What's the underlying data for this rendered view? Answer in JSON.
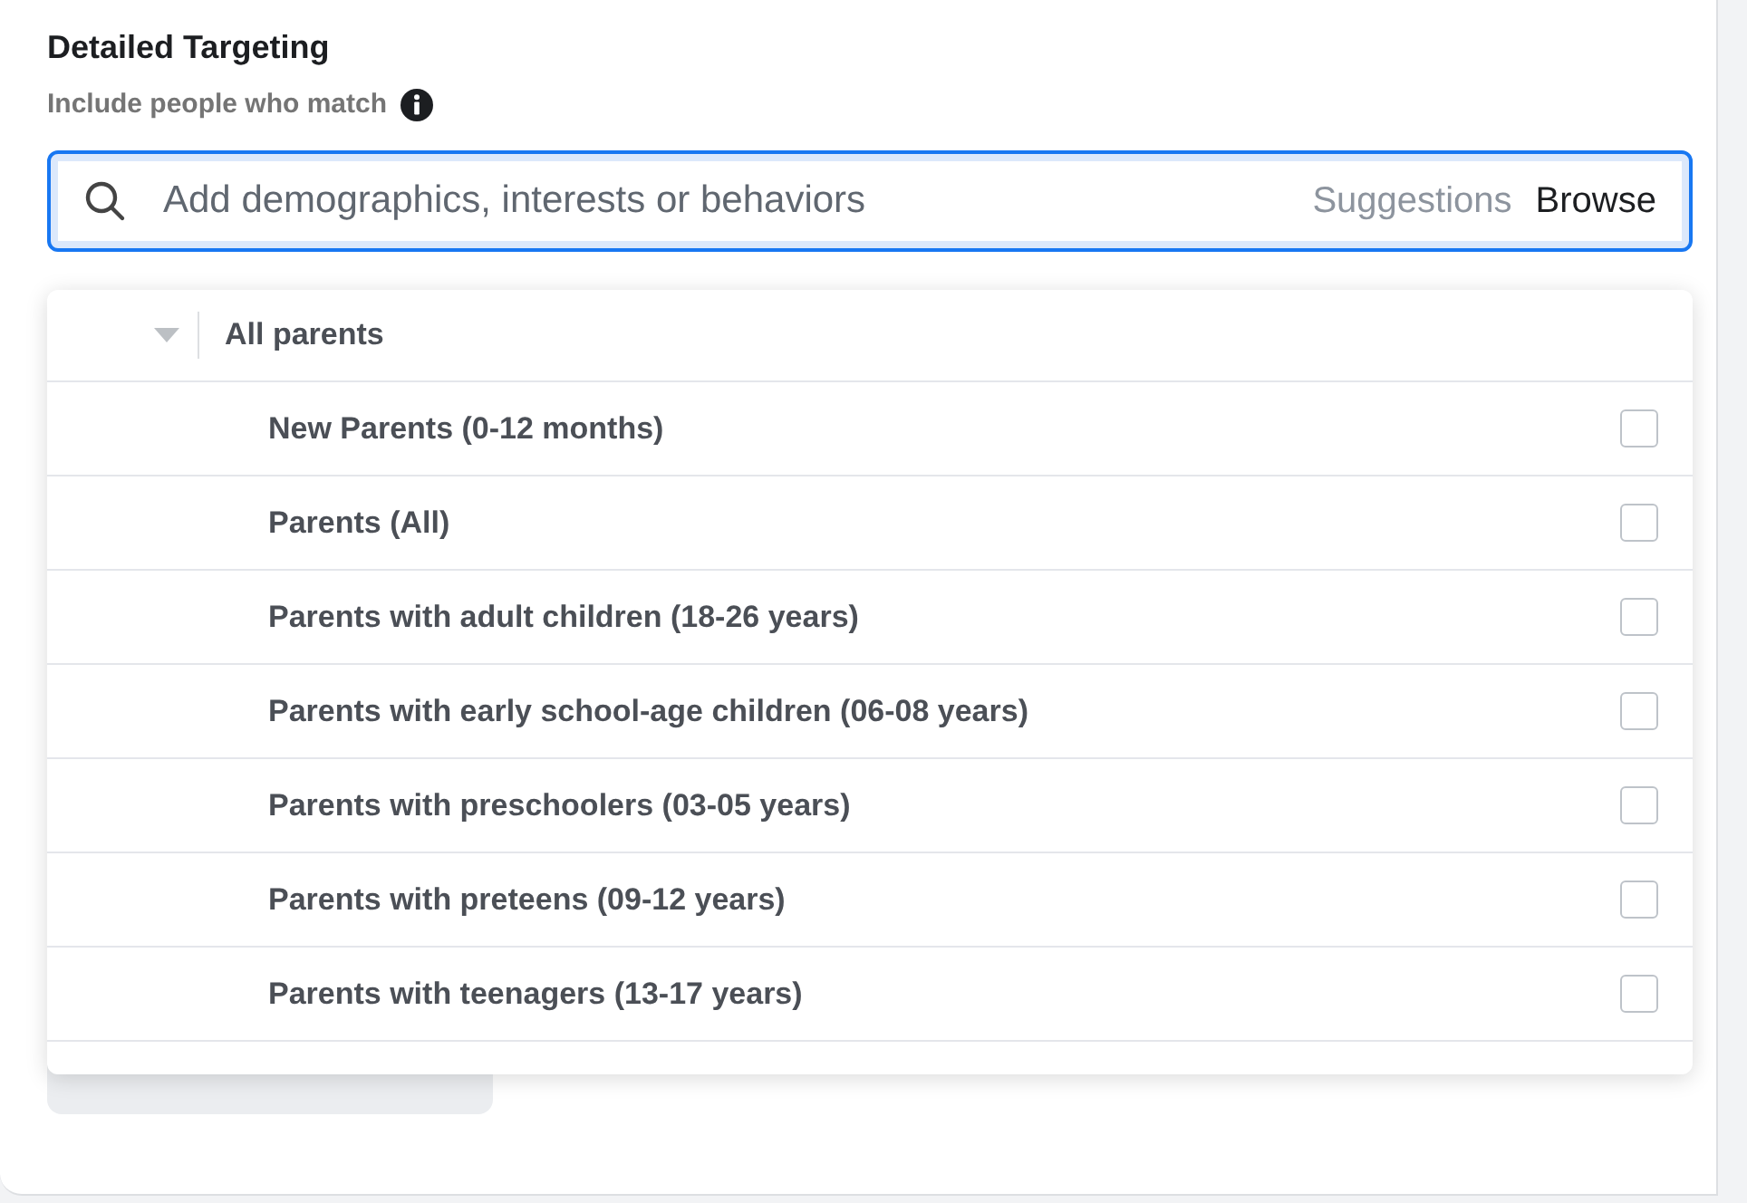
{
  "section": {
    "title": "Detailed Targeting",
    "subtitle": "Include people who match"
  },
  "search": {
    "placeholder": "Add demographics, interests or behaviors",
    "links": [
      {
        "label": "Suggestions",
        "selected": false
      },
      {
        "label": "Browse",
        "selected": true
      }
    ]
  },
  "dropdown": {
    "group": {
      "label": "All parents",
      "expanded": true
    },
    "items": [
      {
        "label": "New Parents (0-12 months)",
        "checked": false
      },
      {
        "label": "Parents (All)",
        "checked": false
      },
      {
        "label": "Parents with adult children (18-26 years)",
        "checked": false
      },
      {
        "label": "Parents with early school-age children (06-08 years)",
        "checked": false
      },
      {
        "label": "Parents with preschoolers (03-05 years)",
        "checked": false
      },
      {
        "label": "Parents with preteens (09-12 years)",
        "checked": false
      },
      {
        "label": "Parents with teenagers (13-17 years)",
        "checked": false
      }
    ]
  }
}
